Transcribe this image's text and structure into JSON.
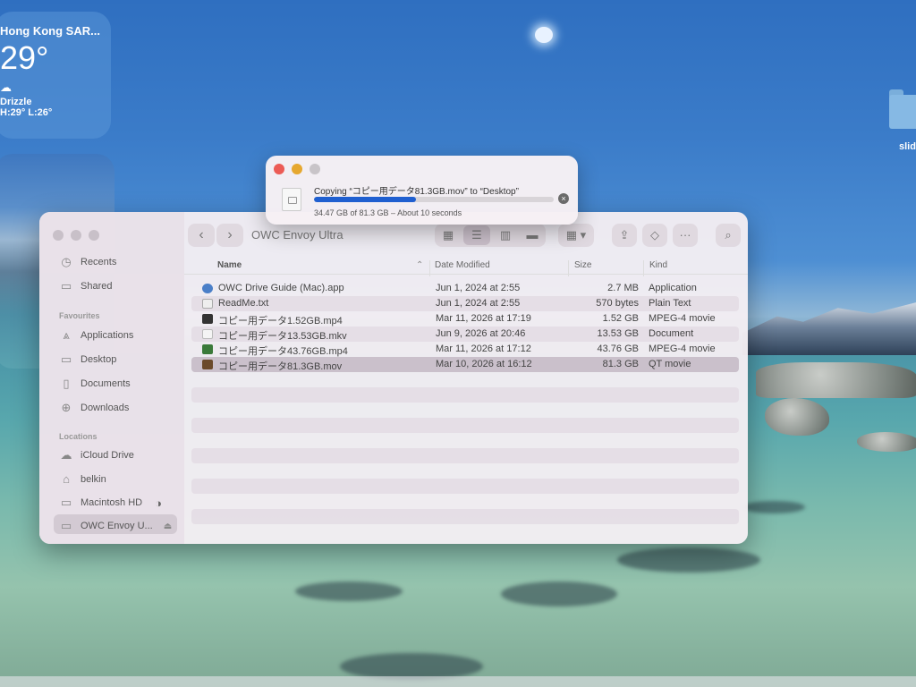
{
  "weather": {
    "city": "Hong Kong SAR...",
    "temperature": "29°",
    "condition_icon": "cloud-drizzle-icon",
    "condition": "Drizzle",
    "high_low": "H:29° L:26°"
  },
  "desktop": {
    "folder_label": "slid"
  },
  "copy_dialog": {
    "title": "Copying “コピー用データ81.3GB.mov” to “Desktop”",
    "status": "34.47 GB of 81.3 GB – About 10 seconds",
    "progress_fraction": 0.424,
    "accent_color": "#1f5fd0"
  },
  "finder": {
    "window_title": "OWC Envoy Ultra",
    "sidebar": {
      "top_items": [
        {
          "label": "Recents",
          "icon": "clock-icon"
        },
        {
          "label": "Shared",
          "icon": "shared-folder-icon"
        }
      ],
      "favourites_heading": "Favourites",
      "favourites": [
        {
          "label": "Applications",
          "icon": "applications-icon"
        },
        {
          "label": "Desktop",
          "icon": "desktop-icon"
        },
        {
          "label": "Documents",
          "icon": "document-icon"
        },
        {
          "label": "Downloads",
          "icon": "download-icon"
        }
      ],
      "locations_heading": "Locations",
      "locations": [
        {
          "label": "iCloud Drive",
          "icon": "cloud-icon"
        },
        {
          "label": "belkin",
          "icon": "home-icon"
        },
        {
          "label": "Macintosh HD",
          "icon": "disk-icon"
        },
        {
          "label": "OWC Envoy U...",
          "icon": "external-disk-icon"
        }
      ]
    },
    "columns": {
      "name": "Name",
      "date_modified": "Date Modified",
      "size": "Size",
      "kind": "Kind"
    },
    "files": [
      {
        "name": "OWC Drive Guide (Mac).app",
        "date": "Jun 1, 2024 at 2:55",
        "size": "2.7 MB",
        "kind": "Application",
        "icon": "app-icon"
      },
      {
        "name": "ReadMe.txt",
        "date": "Jun 1, 2024 at 2:55",
        "size": "570 bytes",
        "kind": "Plain Text",
        "icon": "text-file-icon"
      },
      {
        "name": "コピー用データ1.52GB.mp4",
        "date": "Mar 11, 2026 at 17:19",
        "size": "1.52 GB",
        "kind": "MPEG-4 movie",
        "icon": "video-file-icon"
      },
      {
        "name": "コピー用データ13.53GB.mkv",
        "date": "Jun 9, 2026 at 20:46",
        "size": "13.53 GB",
        "kind": "Document",
        "icon": "document-file-icon"
      },
      {
        "name": "コピー用データ43.76GB.mp4",
        "date": "Mar 11, 2026 at 17:12",
        "size": "43.76 GB",
        "kind": "MPEG-4 movie",
        "icon": "video-file-icon"
      },
      {
        "name": "コピー用データ81.3GB.mov",
        "date": "Mar 10, 2026 at 16:12",
        "size": "81.3 GB",
        "kind": "QT movie",
        "icon": "quicktime-file-icon"
      }
    ]
  }
}
